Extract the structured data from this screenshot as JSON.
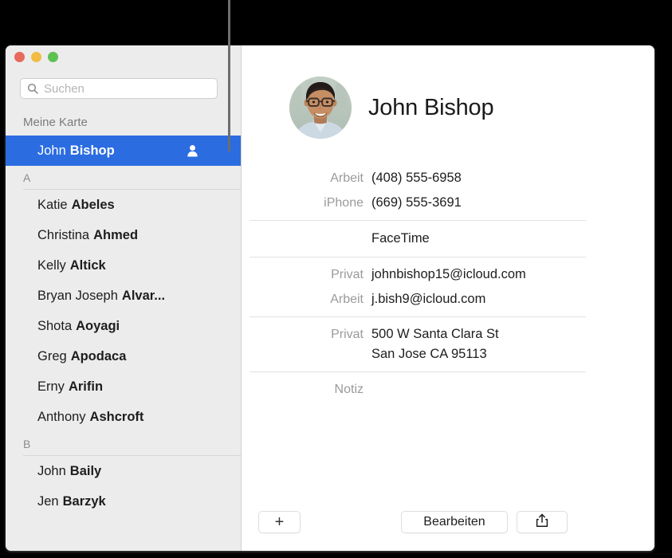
{
  "window": {
    "traffic_lights": [
      {
        "name": "close",
        "color": "#e8695e"
      },
      {
        "name": "minimize",
        "color": "#f0bd42"
      },
      {
        "name": "zoom",
        "color": "#5ec152"
      }
    ],
    "accent_color": "#2b6ce0",
    "background_color": "#000000"
  },
  "sidebar": {
    "search": {
      "placeholder": "Suchen",
      "value": "",
      "icon": "search-icon"
    },
    "groups": [
      {
        "header": "Meine Karte",
        "type": "my-card",
        "contacts": [
          {
            "first": "John",
            "last": "Bishop",
            "selected": true,
            "badge_icon": "person-icon"
          }
        ]
      },
      {
        "header": "A",
        "type": "letter",
        "contacts": [
          {
            "first": "Katie",
            "last": "Abeles",
            "selected": false
          },
          {
            "first": "Christina",
            "last": "Ahmed",
            "selected": false
          },
          {
            "first": "Kelly",
            "last": "Altick",
            "selected": false
          },
          {
            "first": "Bryan Joseph",
            "last": "Alvar...",
            "selected": false
          },
          {
            "first": "Shota",
            "last": "Aoyagi",
            "selected": false
          },
          {
            "first": "Greg",
            "last": "Apodaca",
            "selected": false
          },
          {
            "first": "Erny",
            "last": "Arifin",
            "selected": false
          },
          {
            "first": "Anthony",
            "last": "Ashcroft",
            "selected": false
          }
        ]
      },
      {
        "header": "B",
        "type": "letter",
        "contacts": [
          {
            "first": "John",
            "last": "Baily",
            "selected": false
          },
          {
            "first": "Jen",
            "last": "Barzyk",
            "selected": false
          }
        ]
      }
    ]
  },
  "detail": {
    "name": "John Bishop",
    "avatar_alt": "contact-photo",
    "phones": [
      {
        "label": "Arbeit",
        "value": "(408) 555-6958"
      },
      {
        "label": "iPhone",
        "value": "(669) 555-3691"
      }
    ],
    "facetime": {
      "label": "",
      "value": "FaceTime"
    },
    "emails": [
      {
        "label": "Privat",
        "value": "johnbishop15@icloud.com"
      },
      {
        "label": "Arbeit",
        "value": "j.bish9@icloud.com"
      }
    ],
    "address": {
      "label": "Privat",
      "value": "500 W Santa Clara St\nSan Jose CA 95113"
    },
    "note": {
      "label": "Notiz",
      "value": ""
    }
  },
  "bottom_bar": {
    "add_label": "+",
    "edit_label": "Bearbeiten",
    "share_icon": "share-icon"
  }
}
